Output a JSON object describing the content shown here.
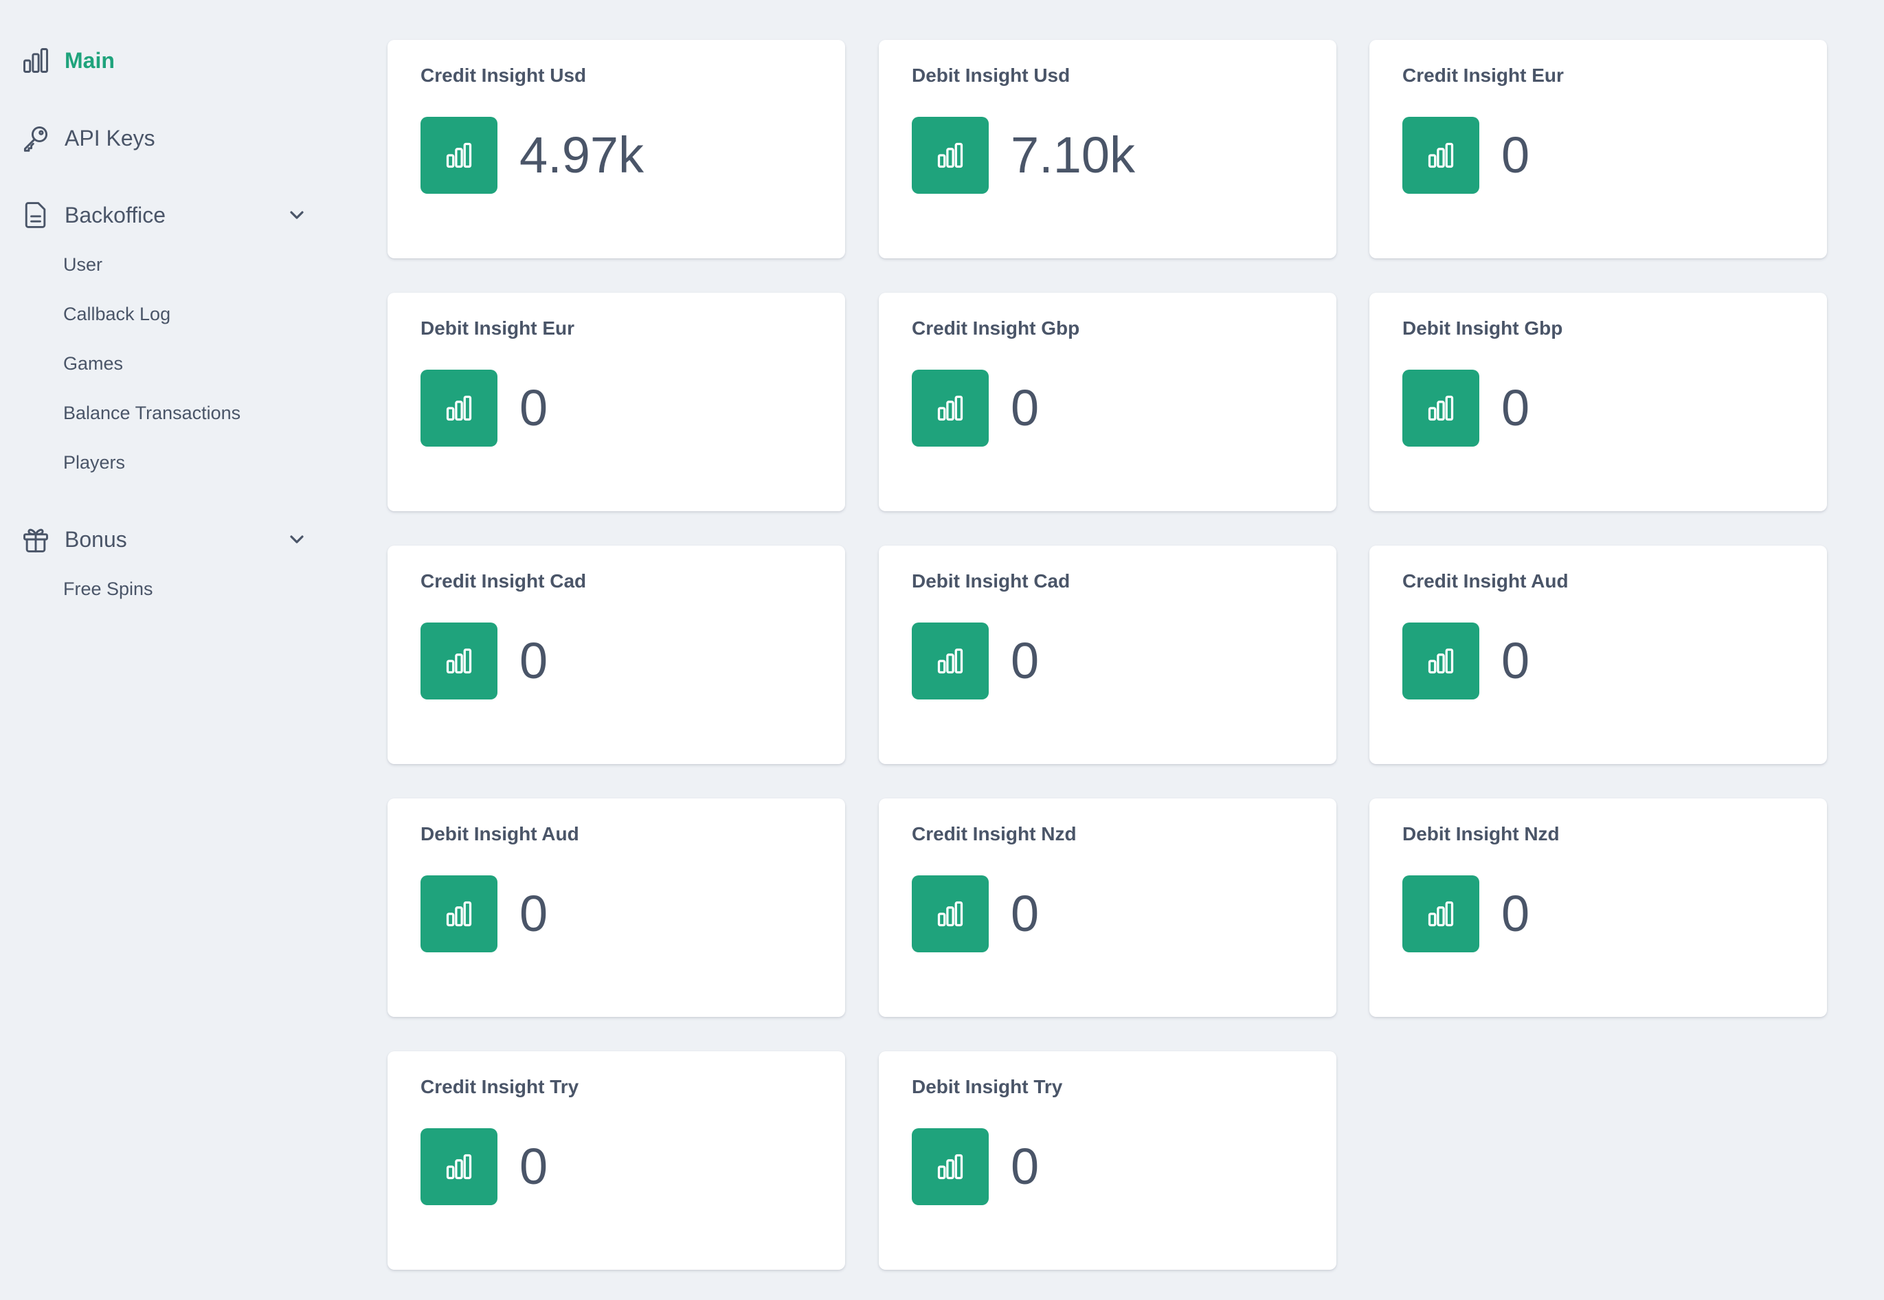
{
  "sidebar": {
    "main": {
      "label": "Main",
      "icon": "chart-bar-icon"
    },
    "api_keys": {
      "label": "API Keys",
      "icon": "key-icon"
    },
    "backoffice": {
      "label": "Backoffice",
      "icon": "document-icon",
      "items": [
        "User",
        "Callback Log",
        "Games",
        "Balance Transactions",
        "Players"
      ]
    },
    "bonus": {
      "label": "Bonus",
      "icon": "gift-icon",
      "items": [
        "Free Spins"
      ]
    },
    "accent_color": "#1fa37c"
  },
  "cards": [
    {
      "title": "Credit Insight Usd",
      "value": "4.97k"
    },
    {
      "title": "Debit Insight Usd",
      "value": "7.10k"
    },
    {
      "title": "Credit Insight Eur",
      "value": "0"
    },
    {
      "title": "Debit Insight Eur",
      "value": "0"
    },
    {
      "title": "Credit Insight Gbp",
      "value": "0"
    },
    {
      "title": "Debit Insight Gbp",
      "value": "0"
    },
    {
      "title": "Credit Insight Cad",
      "value": "0"
    },
    {
      "title": "Debit Insight Cad",
      "value": "0"
    },
    {
      "title": "Credit Insight Aud",
      "value": "0"
    },
    {
      "title": "Debit Insight Aud",
      "value": "0"
    },
    {
      "title": "Credit Insight Nzd",
      "value": "0"
    },
    {
      "title": "Debit Insight Nzd",
      "value": "0"
    },
    {
      "title": "Credit Insight Try",
      "value": "0"
    },
    {
      "title": "Debit Insight Try",
      "value": "0"
    }
  ]
}
